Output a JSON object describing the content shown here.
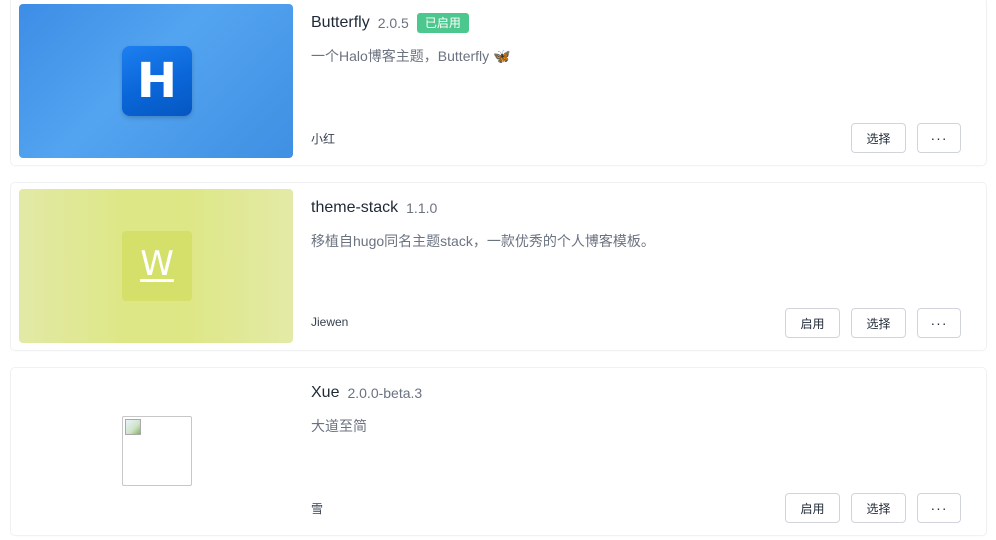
{
  "themes": [
    {
      "name": "Butterfly",
      "version": "2.0.5",
      "badge": "已启用",
      "description": "一个Halo博客主题，Butterfly 🦋",
      "author": "小红",
      "logo_letter": "H",
      "buttons": {
        "select": "选择",
        "more": "···"
      }
    },
    {
      "name": "theme-stack",
      "version": "1.1.0",
      "description": "移植自hugo同名主题stack，一款优秀的个人博客模板。",
      "author": "Jiewen",
      "logo_letter": "W",
      "buttons": {
        "enable": "启用",
        "select": "选择",
        "more": "···"
      }
    },
    {
      "name": "Xue",
      "version": "2.0.0-beta.3",
      "description": "大道至简",
      "author": "雪",
      "buttons": {
        "enable": "启用",
        "select": "选择",
        "more": "···"
      }
    }
  ],
  "colors": {
    "active_badge": "#4cc78d",
    "butterfly_thumb": "#4a9ae9",
    "stack_thumb": "#dde785"
  },
  "icons": [
    "h-logo-icon",
    "w-logo-icon",
    "broken-image-icon",
    "more-icon"
  ]
}
